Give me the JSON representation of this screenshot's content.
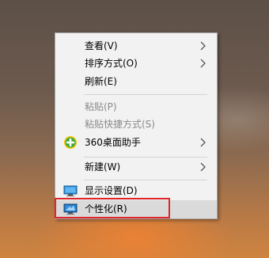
{
  "menu": {
    "items": [
      {
        "label": "查看(V)"
      },
      {
        "label": "排序方式(O)"
      },
      {
        "label": "刷新(E)"
      },
      {
        "label": "粘贴(P)"
      },
      {
        "label": "粘贴快捷方式(S)"
      },
      {
        "label": "360桌面助手"
      },
      {
        "label": "新建(W)"
      },
      {
        "label": "显示设置(D)"
      },
      {
        "label": "个性化(R)"
      }
    ]
  },
  "colors": {
    "highlight_border": "#e0262a",
    "menu_background": "#f2f2f2",
    "disabled_text": "#8a8a8a"
  },
  "icons": [
    "chevron-right-icon",
    "360-plus-icon",
    "monitor-icon",
    "personalize-monitor-icon"
  ]
}
